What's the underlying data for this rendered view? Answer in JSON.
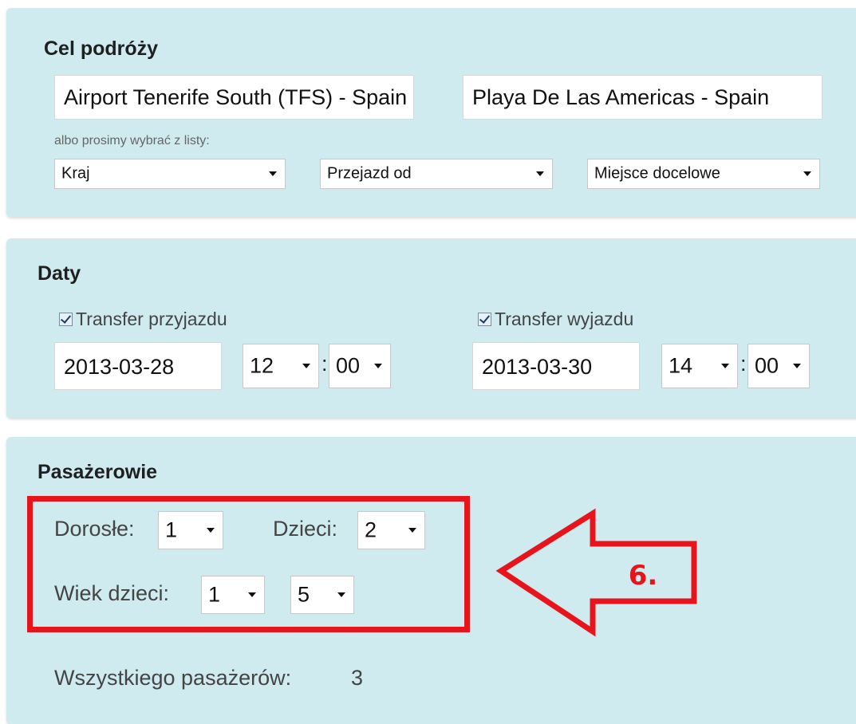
{
  "destination": {
    "title": "Cel podróży",
    "from_value": "Airport Tenerife South (TFS) - Spain",
    "to_value": "Playa De Las Americas - Spain",
    "hint": "albo prosimy wybrać z listy:",
    "country_select": "Kraj",
    "from_select": "Przejazd od",
    "to_select": "Miejsce docelowe"
  },
  "dates": {
    "title": "Daty",
    "arrival": {
      "label": "Transfer przyjazdu",
      "checked": true,
      "date": "2013-03-28",
      "hour": "12",
      "minute": "00"
    },
    "departure": {
      "label": "Transfer wyjazdu",
      "checked": true,
      "date": "2013-03-30",
      "hour": "14",
      "minute": "00"
    },
    "time_separator": ":"
  },
  "passengers": {
    "title": "Pasażerowie",
    "adults_label": "Dorosłe:",
    "adults_value": "1",
    "children_label": "Dzieci:",
    "children_value": "2",
    "children_age_label": "Wiek dzieci:",
    "child1_age": "1",
    "child2_age": "5",
    "total_label": "Wszystkiego pasażerów:",
    "total_value": "3"
  },
  "annotation": {
    "step_label": "6.",
    "color": "#e8141c"
  },
  "colors": {
    "panel_bg": "#cfebef"
  }
}
